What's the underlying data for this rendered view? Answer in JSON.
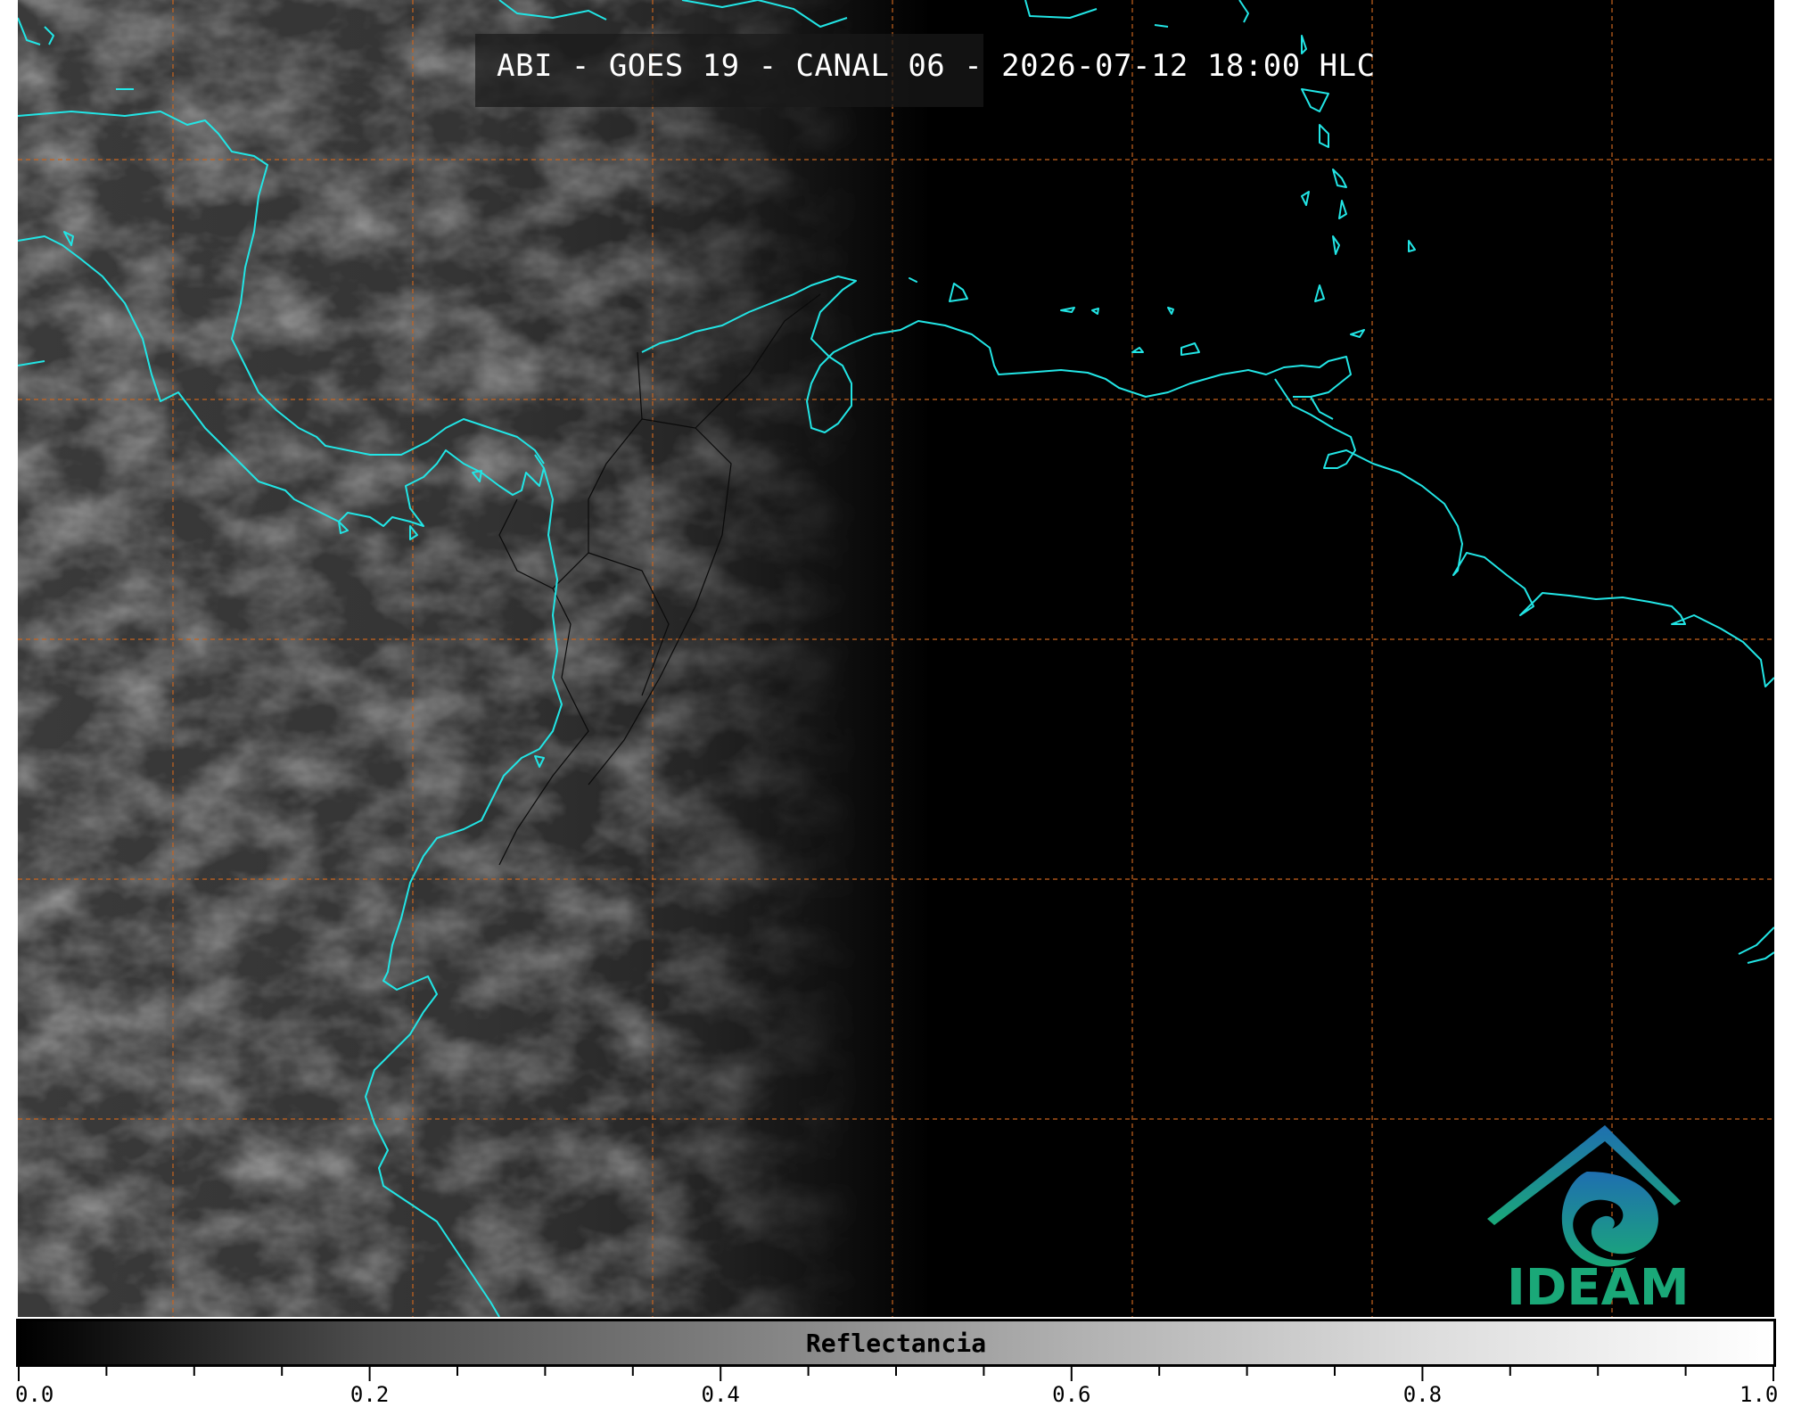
{
  "title": "ABI - GOES 19 - CANAL 06 - 2026-07-12 18:00 HLC",
  "colorbar": {
    "label": "Reflectancia",
    "ticks": [
      "0.0",
      "0.2",
      "0.4",
      "0.6",
      "0.8",
      "1.0"
    ],
    "range": [
      0.0,
      1.0
    ]
  },
  "logo": {
    "text": "IDEAM",
    "icon": "ideam-logo-icon"
  },
  "colors": {
    "coastline": "#22e5e5",
    "gridlines": "#c8641e",
    "background": "#000000",
    "logo_green": "#1aa878",
    "logo_blue": "#1f6fb0"
  }
}
